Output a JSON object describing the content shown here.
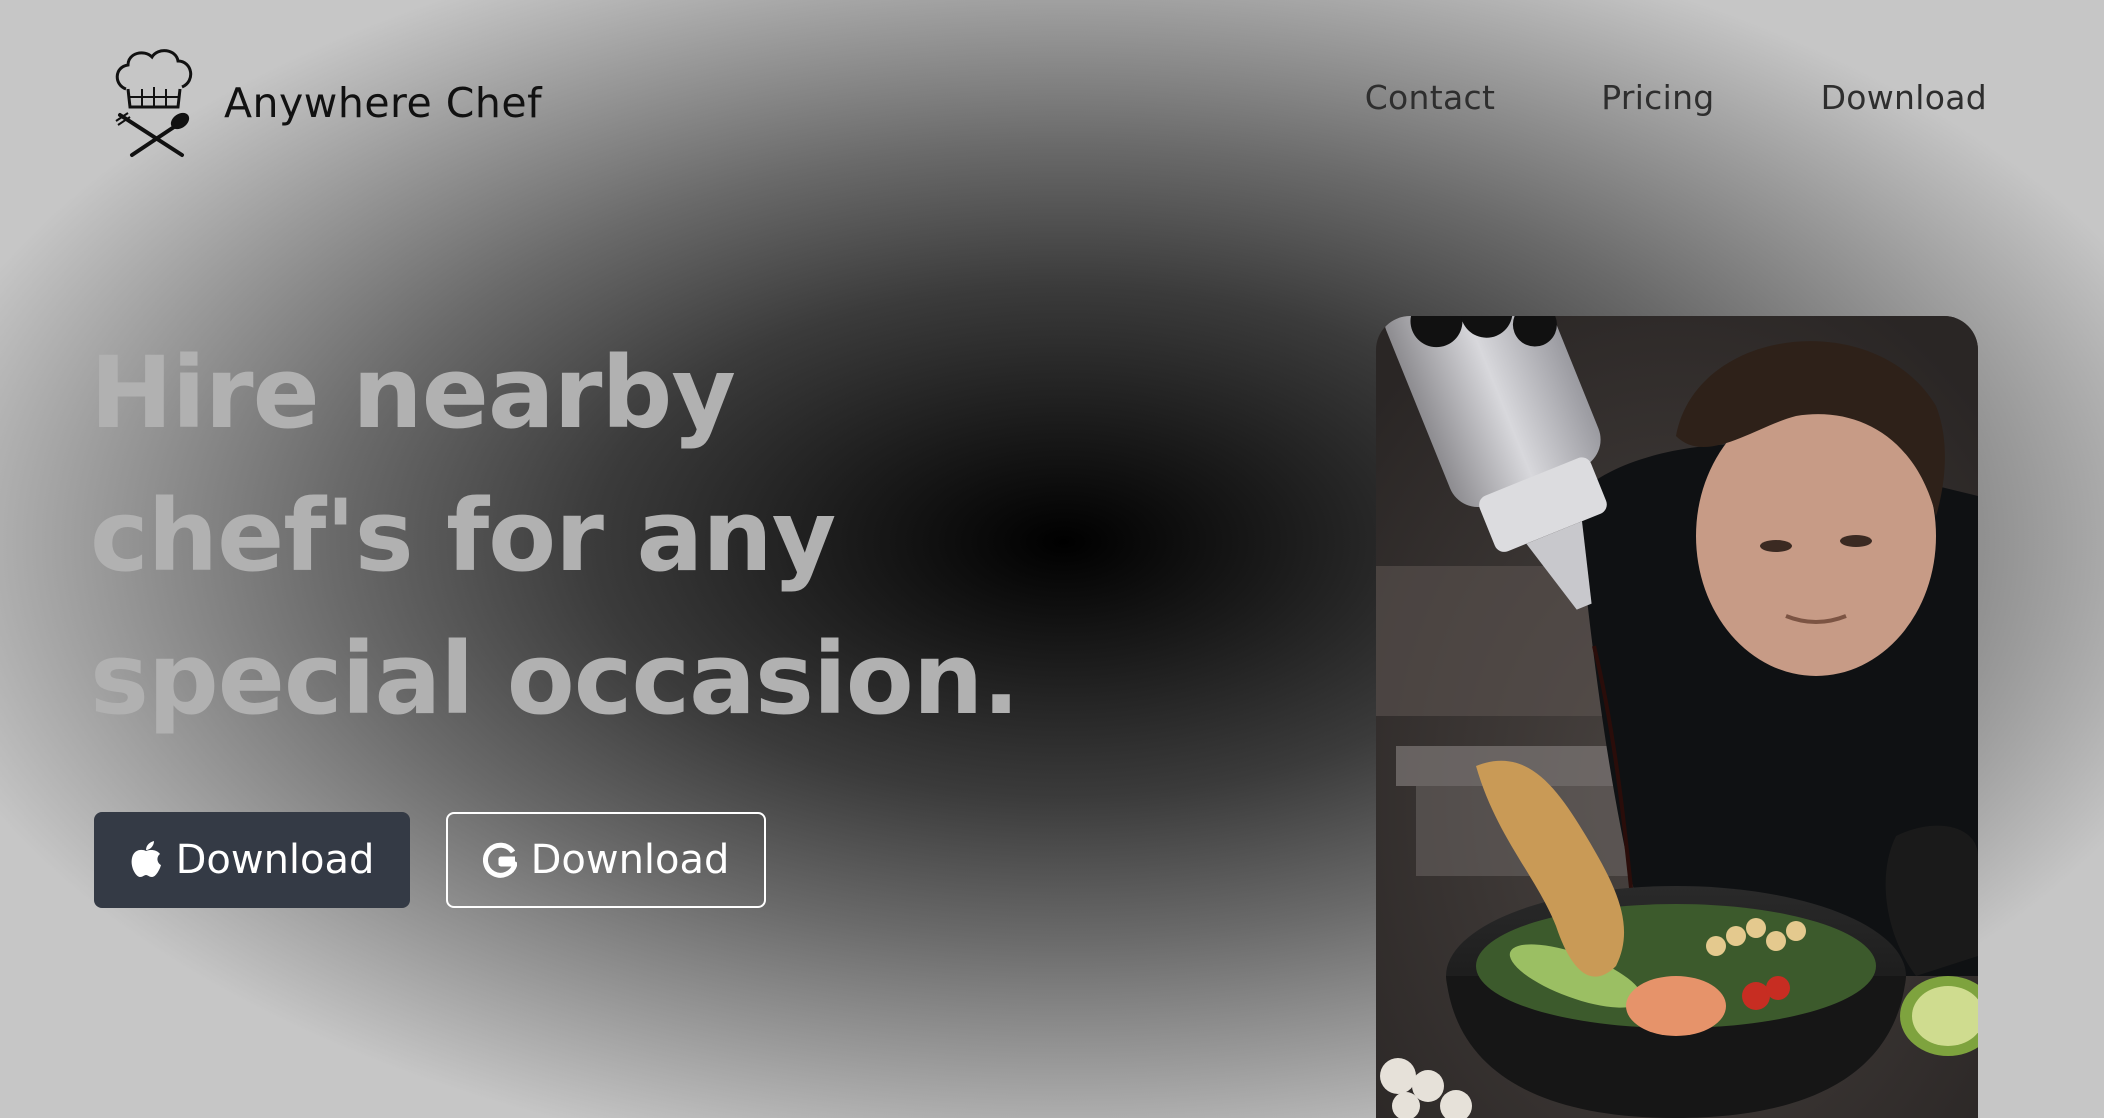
{
  "brand": {
    "name": "Anywhere Chef",
    "logo_icon": "chef-hat-utensils-icon"
  },
  "nav": {
    "items": [
      {
        "label": "Contact"
      },
      {
        "label": "Pricing"
      },
      {
        "label": "Download"
      }
    ]
  },
  "hero": {
    "headline_lines": [
      "Hire nearby",
      "chef's for any",
      "special occasion."
    ],
    "photo_icon": "chef-plating-photo"
  },
  "cta": {
    "apple": {
      "label": "Download",
      "icon": "apple-icon"
    },
    "google": {
      "label": "Download",
      "icon": "google-icon"
    }
  },
  "colors": {
    "brand_text": "#111111",
    "headline": "#b1b1b1",
    "apple_button_bg": "#343a45",
    "button_text": "#ffffff"
  }
}
